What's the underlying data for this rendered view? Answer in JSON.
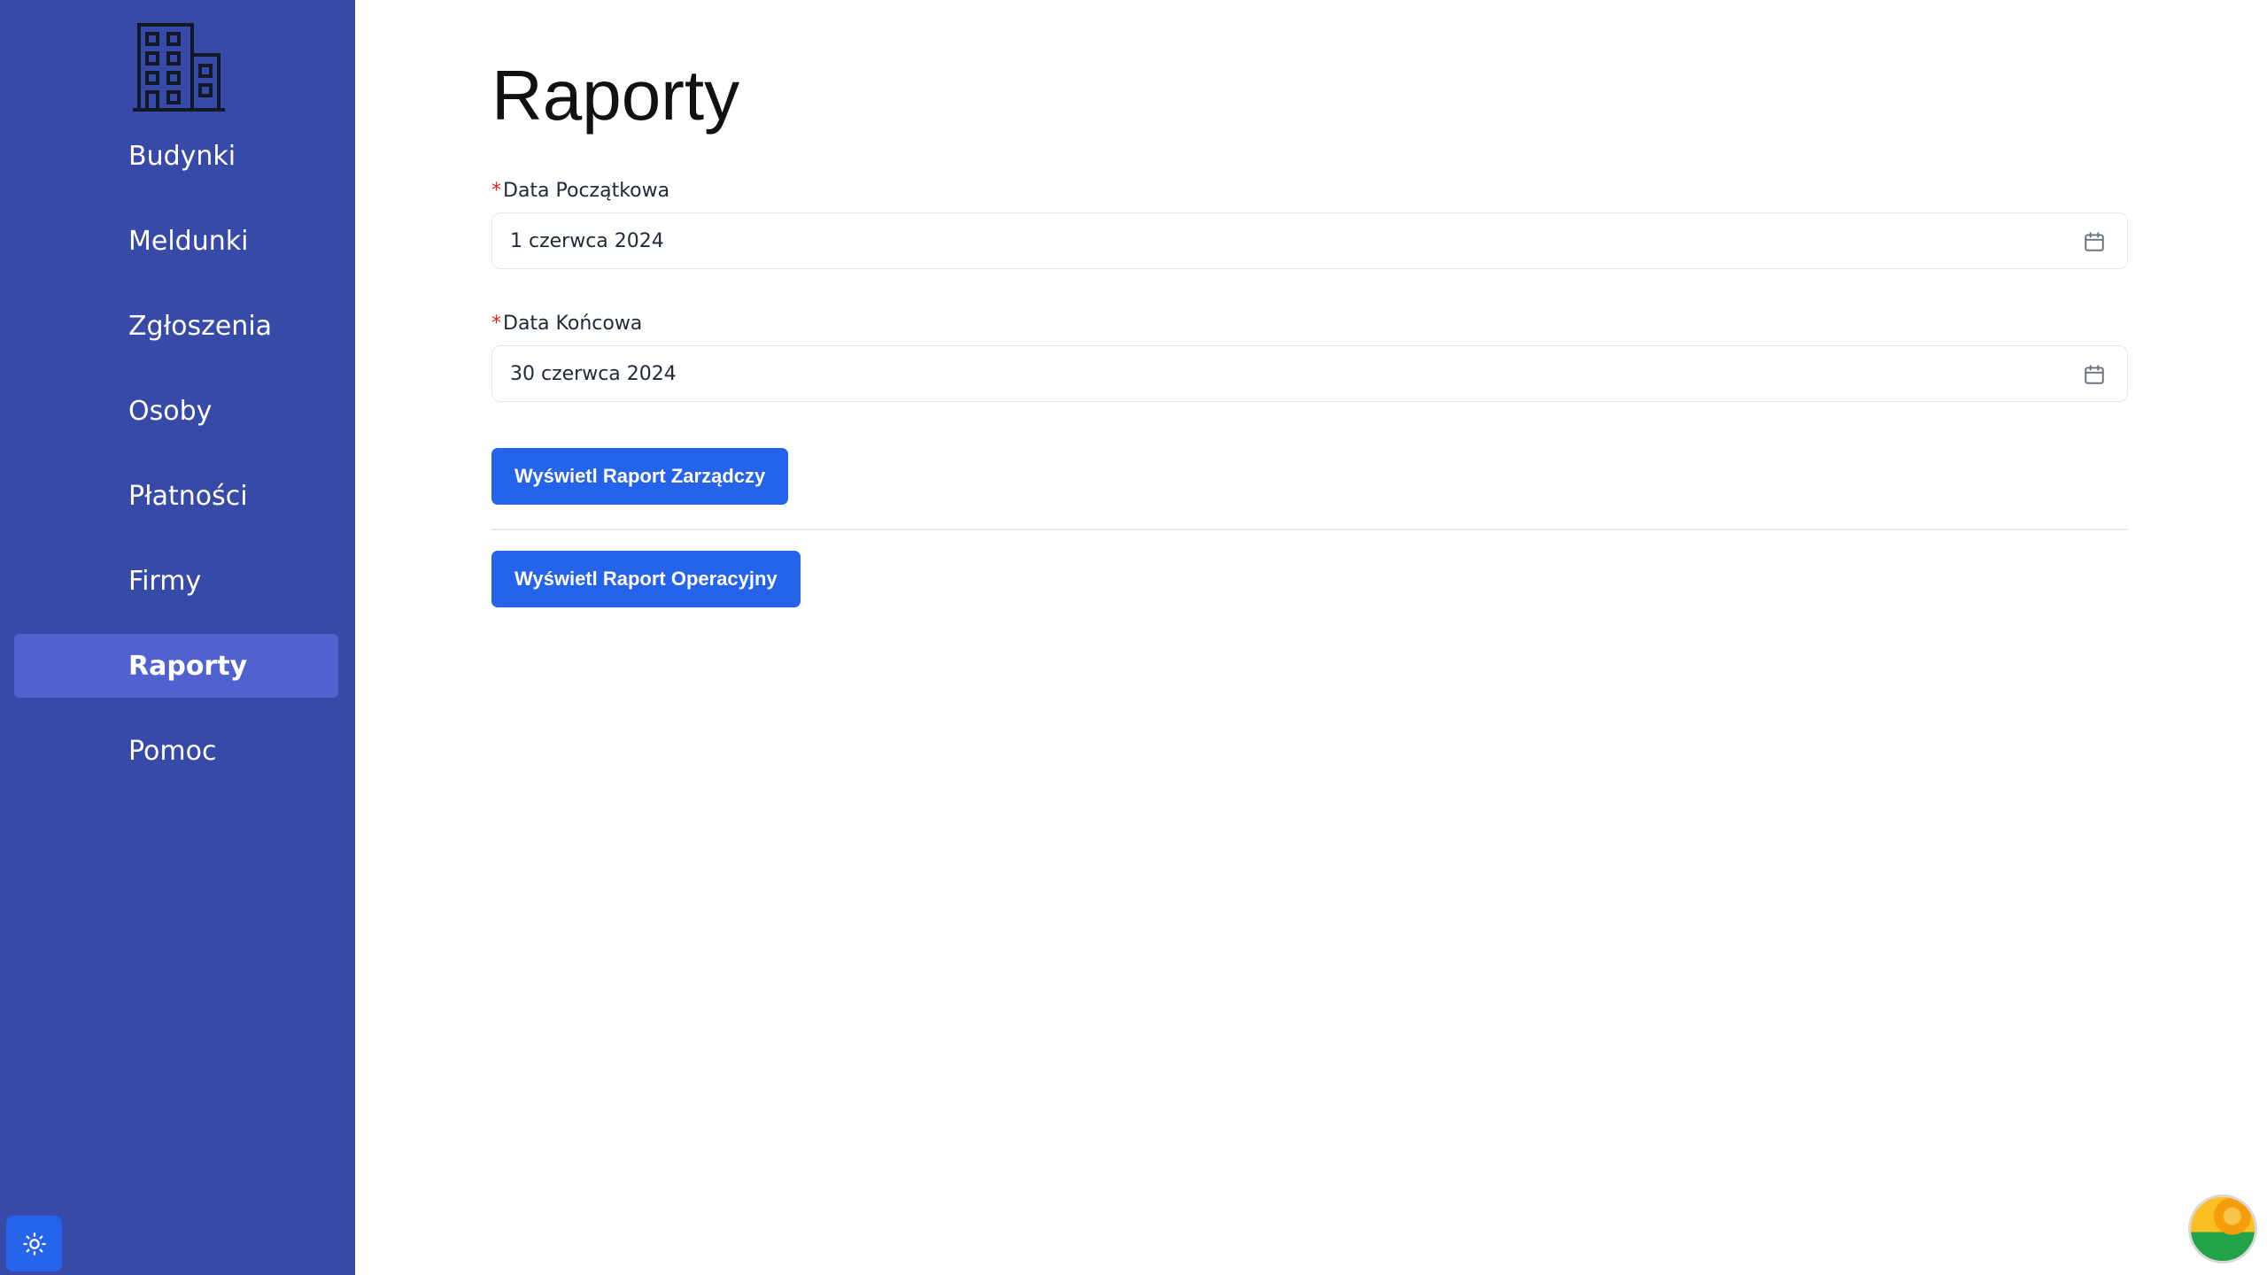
{
  "sidebar": {
    "items": [
      {
        "label": "Budynki"
      },
      {
        "label": "Meldunki"
      },
      {
        "label": "Zgłoszenia"
      },
      {
        "label": "Osoby"
      },
      {
        "label": "Płatności"
      },
      {
        "label": "Firmy"
      },
      {
        "label": "Raporty",
        "active": true
      },
      {
        "label": "Pomoc"
      }
    ],
    "logo_icon": "building-icon",
    "theme_toggle_icon": "sun-icon"
  },
  "page": {
    "title": "Raporty"
  },
  "form": {
    "start_date": {
      "required_mark": "*",
      "label": "Data Początkowa",
      "value": "1 czerwca 2024",
      "icon": "calendar-icon"
    },
    "end_date": {
      "required_mark": "*",
      "label": "Data Końcowa",
      "value": "30 czerwca 2024",
      "icon": "calendar-icon"
    },
    "management_report_button": "Wyświetl Raport Zarządczy",
    "operational_report_button": "Wyświetl Raport Operacyjny"
  },
  "colors": {
    "sidebar_bg": "#374aa8",
    "sidebar_active_bg": "#5161d0",
    "primary": "#2563eb",
    "required": "#dc2626"
  }
}
